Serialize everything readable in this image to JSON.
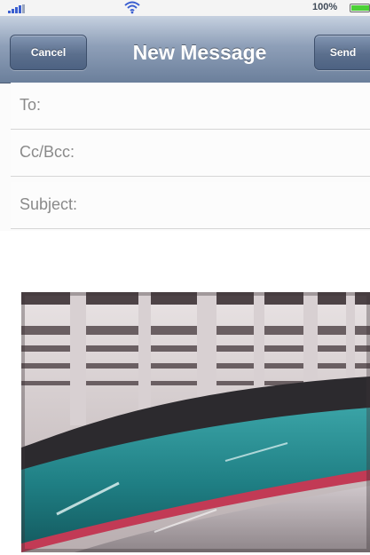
{
  "status_bar": {
    "battery_text": "100%",
    "signal_icon": "signal-bars-icon",
    "wifi_icon": "wifi-icon",
    "battery_icon": "battery-full-icon",
    "battery_color": "#4cd137"
  },
  "nav": {
    "cancel_label": "Cancel",
    "title": "New Message",
    "send_label": "Send"
  },
  "fields": {
    "to_label": "To:",
    "to_value": "",
    "cc_label": "Cc/Bcc:",
    "cc_value": "",
    "subject_label": "Subject:",
    "subject_value": ""
  },
  "attachment": {
    "type": "photo",
    "subject": "high-speed train nose in station",
    "colors": {
      "body": "#1f7f84",
      "stripe": "#c23a55",
      "structure": "#5a5050"
    }
  }
}
